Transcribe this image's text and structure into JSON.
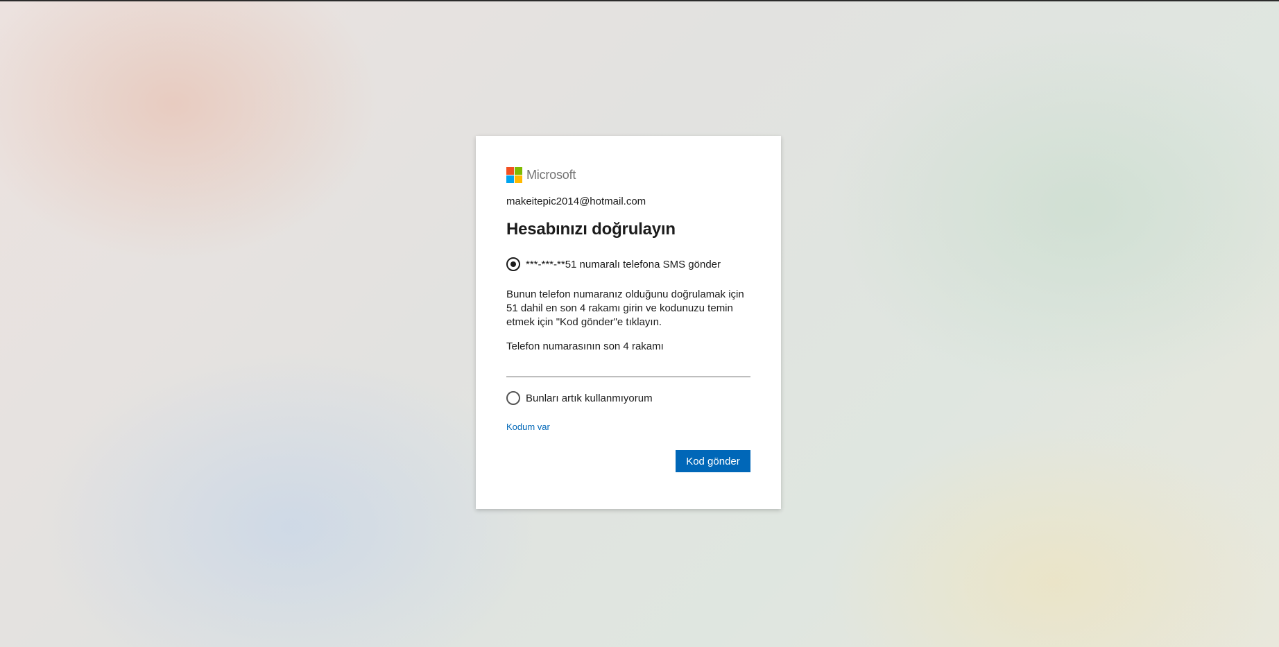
{
  "brand": {
    "name": "Microsoft",
    "logo_colors": [
      "#f25022",
      "#7fba00",
      "#00a4ef",
      "#ffb900"
    ]
  },
  "account": {
    "email": "makeitepic2014@hotmail.com"
  },
  "page": {
    "title": "Hesabınızı doğrulayın"
  },
  "options": {
    "sms": {
      "label": "***-***-**51 numaralı telefona SMS gönder",
      "selected": true
    },
    "none": {
      "label": "Bunları artık kullanmıyorum",
      "selected": false
    }
  },
  "verify": {
    "description": "Bunun telefon numaranız olduğunu doğrulamak için 51 dahil en son 4 rakamı girin ve kodunuzu temin etmek için \"Kod gönder\"e tıklayın.",
    "field_label": "Telefon numarasının son 4 rakamı",
    "input_value": ""
  },
  "actions": {
    "have_code_link": "Kodum var",
    "send_code_button": "Kod gönder"
  },
  "colors": {
    "accent": "#0067b8",
    "text": "#1b1b1b"
  }
}
